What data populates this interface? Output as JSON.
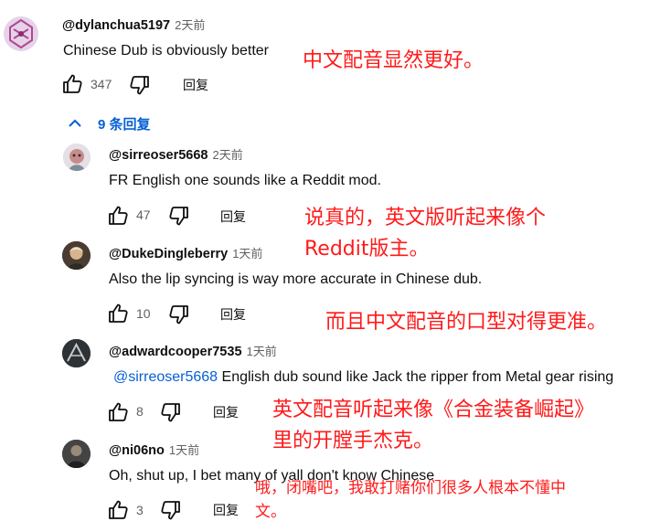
{
  "top_comment": {
    "handle": "@dylanchua5197",
    "time": "2天前",
    "text": "Chinese Dub is obviously better",
    "likes": "347",
    "reply_label": "回复"
  },
  "replies_toggle": {
    "label": "9 条回复"
  },
  "replies": [
    {
      "handle": "@sirreoser5668",
      "time": "2天前",
      "text": "FR English one sounds like a Reddit mod.",
      "likes": "47",
      "reply_label": "回复"
    },
    {
      "handle": "@DukeDingleberry",
      "time": "1天前",
      "text": "Also the lip syncing is way more accurate in Chinese dub.",
      "likes": "10",
      "reply_label": "回复"
    },
    {
      "handle": "@adwardcooper7535",
      "time": "1天前",
      "mention": "@sirreoser5668",
      "text": " English dub sound like Jack the ripper from Metal gear rising",
      "likes": "8",
      "reply_label": "回复"
    },
    {
      "handle": "@ni06no",
      "time": "1天前",
      "text": "Oh, shut up, I bet many of yall don't know Chinese",
      "likes": "3",
      "reply_label": "回复"
    }
  ],
  "annotations": {
    "a1": "中文配音显然更好。",
    "a2_line1": "说真的，英文版听起来像个",
    "a2_line2": "Reddit版主。",
    "a3": "而且中文配音的口型对得更准。",
    "a4_line1": "英文配音听起来像《合金装备崛起》",
    "a4_line2": "里的开膛手杰克。",
    "a5_line1": "哦，闭嘴吧，我敢打赌你们很多人根本不懂中",
    "a5_line2": "文。"
  },
  "colors": {
    "link": "#065fd4",
    "annotation": "#ff1a1a",
    "secondary_text": "#606060"
  },
  "icons": [
    "thumbs-up-icon",
    "thumbs-down-icon",
    "chevron-up-icon"
  ]
}
